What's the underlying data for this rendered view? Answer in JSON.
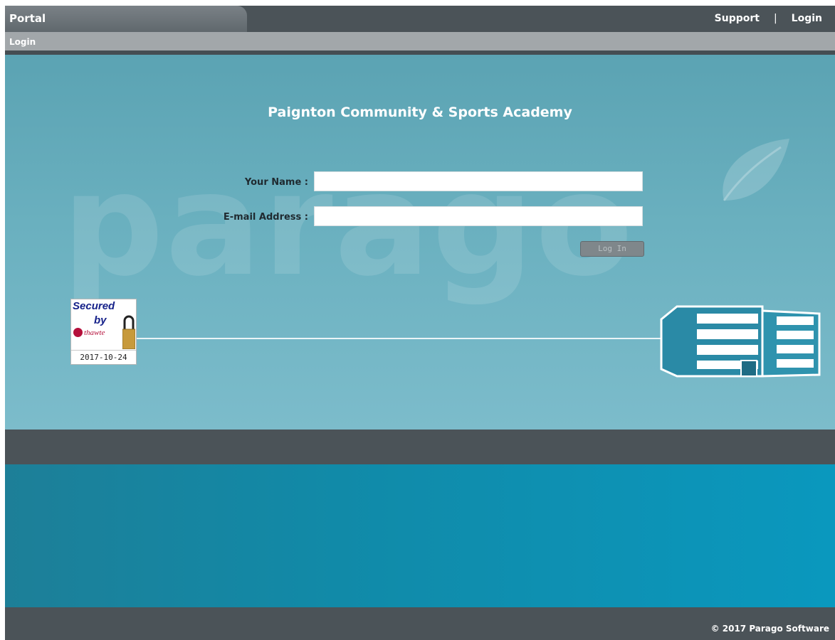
{
  "header": {
    "portal_label": "Portal",
    "support_link": "Support",
    "separator": "|",
    "login_link": "Login",
    "sub_label": "Login"
  },
  "main": {
    "school_name": "Paignton Community & Sports Academy",
    "watermark": "parago",
    "name_label": "Your Name :",
    "name_value": "",
    "email_label": "E-mail Address :",
    "email_value": "",
    "login_button": "Log In"
  },
  "badge": {
    "secured": "Secured",
    "by": "by",
    "brand": "thawte",
    "date": "2017-10-24"
  },
  "footer": {
    "copyright": "© 2017 Parago Software"
  },
  "colors": {
    "topbar": "#4b5358",
    "hero": "#6ab0bf",
    "teal_band": "#0a98be"
  }
}
